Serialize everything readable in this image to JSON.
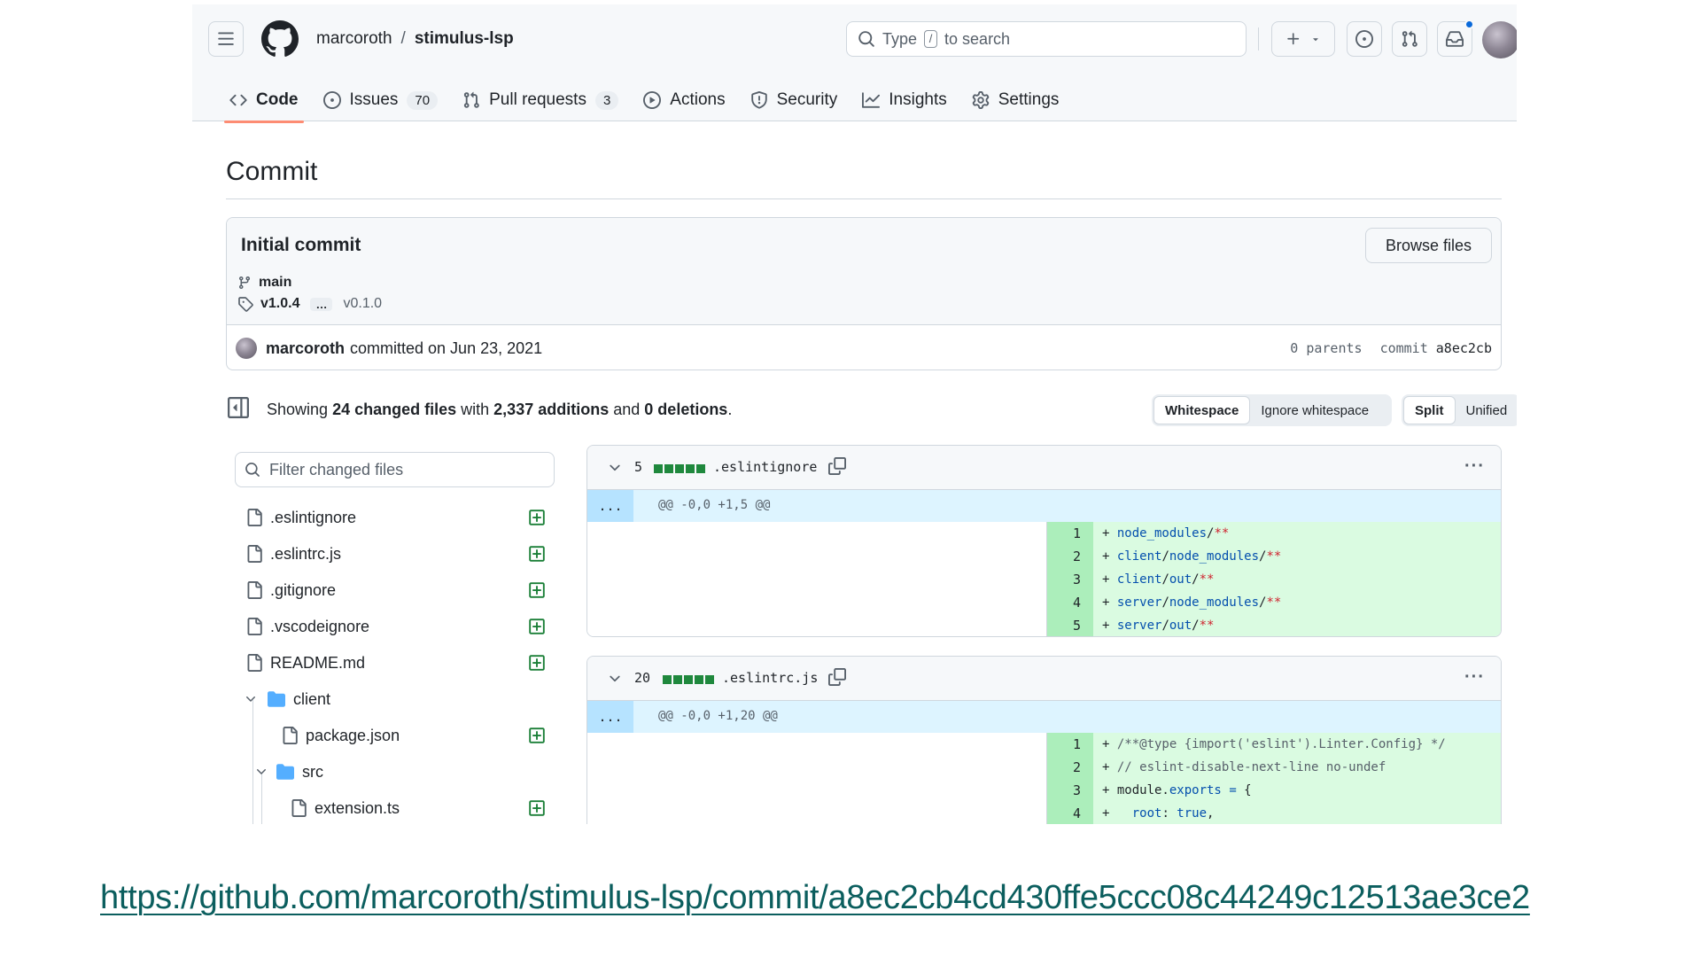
{
  "header": {
    "owner": "marcoroth",
    "separator": "/",
    "repo": "stimulus-lsp",
    "search_prefix": "Type",
    "search_key": "/",
    "search_suffix": "to search"
  },
  "tabs": [
    {
      "label": "Code",
      "icon": "code-icon",
      "active": true
    },
    {
      "label": "Issues",
      "icon": "issue-icon",
      "count": "70"
    },
    {
      "label": "Pull requests",
      "icon": "pull-request-icon",
      "count": "3"
    },
    {
      "label": "Actions",
      "icon": "play-icon"
    },
    {
      "label": "Security",
      "icon": "shield-icon"
    },
    {
      "label": "Insights",
      "icon": "graph-icon"
    },
    {
      "label": "Settings",
      "icon": "gear-icon"
    }
  ],
  "page": {
    "title": "Commit"
  },
  "commit": {
    "message": "Initial commit",
    "browse_label": "Browse files",
    "branch": "main",
    "tag": "v1.0.4",
    "tag_more": "…",
    "tag_last": "v0.1.0",
    "author": "marcoroth",
    "committed_text": "committed on Jun 23, 2021",
    "parents_text": "0 parents",
    "commit_label": "commit",
    "sha": "a8ec2cb"
  },
  "summary": {
    "prefix": "Showing",
    "files": "24 changed files",
    "with": "with",
    "additions": "2,337 additions",
    "and": "and",
    "deletions": "0 deletions",
    "end": ".",
    "whitespace_label": "Whitespace",
    "ignore_whitespace_label": "Ignore whitespace",
    "split_label": "Split",
    "unified_label": "Unified"
  },
  "file_tree": {
    "filter_placeholder": "Filter changed files",
    "items": [
      {
        "name": ".eslintignore",
        "type": "file"
      },
      {
        "name": ".eslintrc.js",
        "type": "file"
      },
      {
        "name": ".gitignore",
        "type": "file"
      },
      {
        "name": ".vscodeignore",
        "type": "file"
      },
      {
        "name": "README.md",
        "type": "file"
      },
      {
        "name": "client",
        "type": "folder"
      },
      {
        "name": "package.json",
        "type": "file"
      },
      {
        "name": "src",
        "type": "folder"
      },
      {
        "name": "extension.ts",
        "type": "file"
      }
    ]
  },
  "diffs": [
    {
      "count": "5",
      "filename": ".eslintignore",
      "hunk_expander": "...",
      "hunk": "@@ -0,0 +1,5 @@",
      "lines": [
        {
          "n": "1"
        },
        {
          "n": "2"
        },
        {
          "n": "3"
        },
        {
          "n": "4"
        },
        {
          "n": "5"
        }
      ]
    },
    {
      "count": "20",
      "filename": ".eslintrc.js",
      "hunk_expander": "...",
      "hunk": "@@ -0,0 +1,20 @@",
      "lines": [
        {
          "n": "1"
        },
        {
          "n": "2"
        },
        {
          "n": "3"
        },
        {
          "n": "4"
        }
      ]
    }
  ],
  "caption": {
    "url": "https://github.com/marcoroth/stimulus-lsp/commit/a8ec2cb4cd430ffe5ccc08c44249c12513ae3ce2"
  },
  "colors": {
    "added_line_bg": "#dafbe1",
    "added_gutter_bg": "#aceebb",
    "hunk_bg": "#ddf4ff",
    "active_tab_underline": "#fd8c73",
    "add_icon": "#1a7f37",
    "folder_icon": "#54aeff",
    "caption_link": "#0b5e5e"
  }
}
